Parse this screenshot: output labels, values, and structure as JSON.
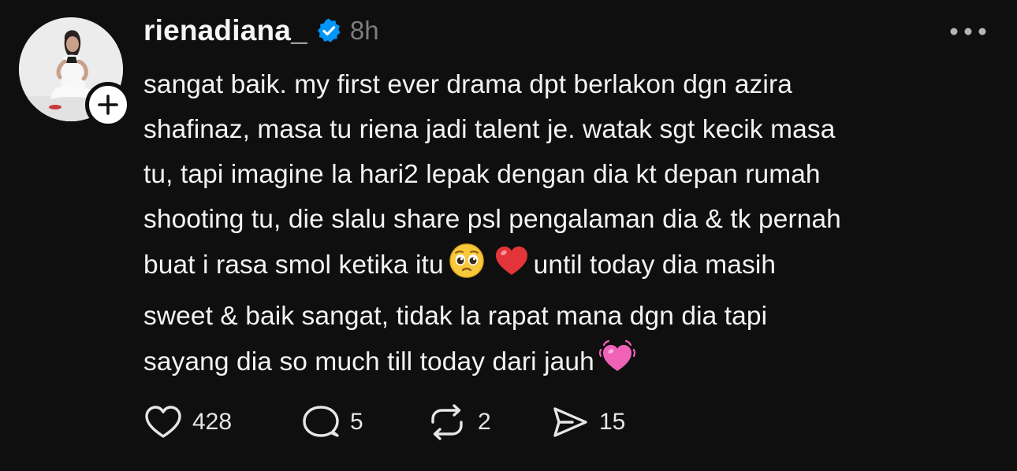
{
  "post": {
    "author": {
      "username": "rienadiana_",
      "verified": true,
      "avatar_icon": "profile-photo",
      "follow_icon": "plus-icon"
    },
    "timestamp": "8h",
    "menu_icon": "more-horizontal-icon",
    "text_segments": {
      "part1": "sangat baik. my first ever drama dpt berlakon dgn azira\nshafinaz, masa tu riena jadi talent je. watak sgt kecik masa\ntu, tapi imagine la hari2 lepak dengan dia kt depan rumah\nshooting tu, die slalu share psl pengalaman dia & tk pernah\nbuat i rasa smol ketika itu",
      "emoji1": "🥹",
      "emoji2": "❤️",
      "part2": "until today dia masih\nsweet & baik sangat, tidak la rapat mana dgn dia tapi\nsayang dia so much till today dari jauh",
      "emoji3": "💓"
    },
    "stats": {
      "likes": "428",
      "replies": "5",
      "reposts": "2",
      "shares": "15"
    }
  },
  "colors": {
    "background": "#0f0f0f",
    "text": "#f3f3f3",
    "muted": "#7d7d7d",
    "verified_blue": "#0095f6"
  }
}
